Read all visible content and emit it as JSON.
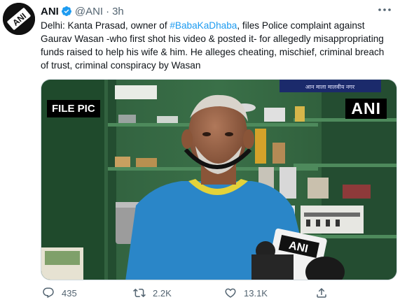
{
  "tweet": {
    "display_name": "ANI",
    "handle": "@ANI",
    "separator": "·",
    "time": "3h",
    "avatar_text": "ANI",
    "text_before": "Delhi: Kanta Prasad, owner of ",
    "hashtag": "#BabaKaDhaba",
    "text_after": ", files Police complaint against Gaurav Wasan -who first shot his video & posted it- for allegedly misappropriating funds raised to help his wife & him. He alleges cheating, mischief, criminal breach of trust, criminal conspiracy by Wasan",
    "media": {
      "file_pic_label": "FILE PIC",
      "watermark": "ANI",
      "mic_label": "ANI",
      "sign_text": "आन माला मालवीय नगर"
    },
    "actions": {
      "reply_count": "435",
      "retweet_count": "2.2K",
      "like_count": "13.1K"
    }
  },
  "colors": {
    "accent": "#1d9bf0",
    "text": "#0f1419",
    "secondary": "#536471"
  }
}
